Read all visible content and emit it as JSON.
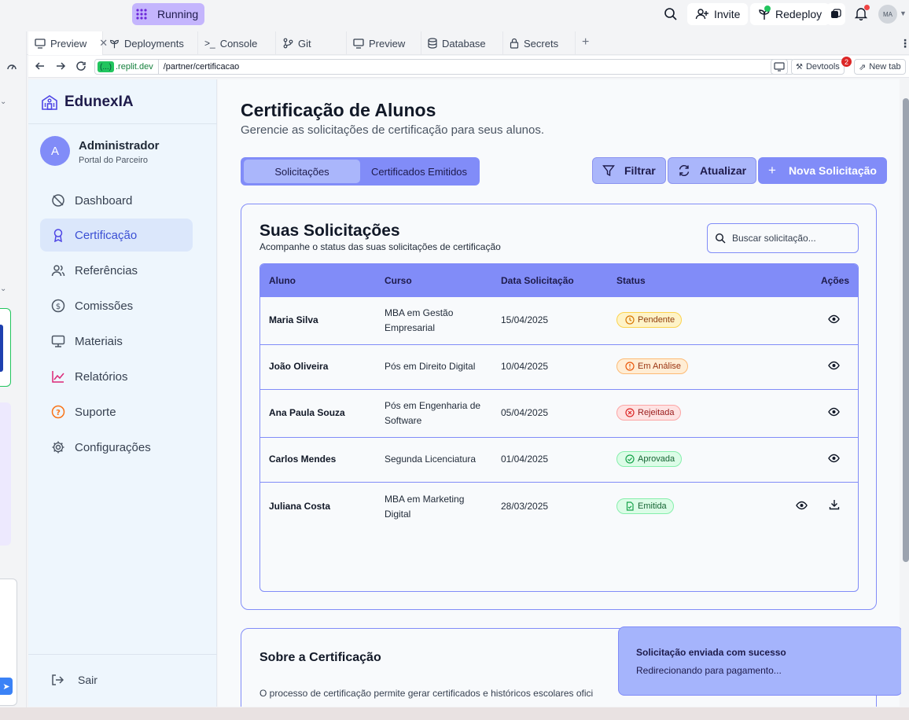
{
  "topbar": {
    "run_status": "Running",
    "invite_label": "Invite",
    "redeploy_label": "Redeploy",
    "avatar_initials": "MA"
  },
  "tabs": [
    {
      "label": "Preview",
      "icon": "monitor-icon",
      "active": true
    },
    {
      "label": "Deployments",
      "icon": "deploy-icon"
    },
    {
      "label": "Console",
      "icon": "terminal-icon"
    },
    {
      "label": "Git",
      "icon": "git-icon"
    },
    {
      "label": "Preview",
      "icon": "monitor-icon"
    },
    {
      "label": "Database",
      "icon": "database-icon"
    },
    {
      "label": "Secrets",
      "icon": "lock-icon"
    }
  ],
  "urlbar": {
    "chip": "(...)",
    "domain": ".replit.dev",
    "path": "/partner/certificacao",
    "devtools_label": "Devtools",
    "devtools_badge": "2",
    "newtab_label": "New tab"
  },
  "sidebar": {
    "brand": "EdunexIA",
    "user_initial": "A",
    "user_name": "Administrador",
    "user_role": "Portal do Parceiro",
    "items": [
      {
        "label": "Dashboard",
        "icon": "dashboard-icon"
      },
      {
        "label": "Certificação",
        "icon": "award-icon",
        "active": true
      },
      {
        "label": "Referências",
        "icon": "users-icon"
      },
      {
        "label": "Comissões",
        "icon": "dollar-icon"
      },
      {
        "label": "Materiais",
        "icon": "monitor-icon"
      },
      {
        "label": "Relatórios",
        "icon": "chart-line-icon"
      },
      {
        "label": "Suporte",
        "icon": "help-icon"
      },
      {
        "label": "Configurações",
        "icon": "gear-icon"
      }
    ],
    "logout_label": "Sair"
  },
  "main": {
    "title": "Certificação de Alunos",
    "subtitle": "Gerencie as solicitações de certificação para seus alunos.",
    "segment": {
      "tab1": "Solicitações",
      "tab2": "Certificados Emitidos"
    },
    "buttons": {
      "filter": "Filtrar",
      "refresh": "Atualizar",
      "new": "Nova Solicitação"
    },
    "requests": {
      "title": "Suas Solicitações",
      "subtitle": "Acompanhe o status das suas solicitações de certificação",
      "search_placeholder": "Buscar solicitação...",
      "columns": [
        "Aluno",
        "Curso",
        "Data Solicitação",
        "Status",
        "Ações"
      ],
      "rows": [
        {
          "student": "Maria Silva",
          "course_line1": "MBA em Gestão",
          "course_line2": "Empresarial",
          "date": "15/04/2025",
          "status": "Pendente",
          "status_color": "#fef3c7"
        },
        {
          "student": "João Oliveira",
          "course_line1": "Pós em Direito Digital",
          "course_line2": "",
          "date": "10/04/2025",
          "status": "Em Análise",
          "status_color": "#ffedd5"
        },
        {
          "student": "Ana Paula Souza",
          "course_line1": "Pós em Engenharia de",
          "course_line2": "Software",
          "date": "05/04/2025",
          "status": "Rejeitada",
          "status_color": "#fee2e2"
        },
        {
          "student": "Carlos Mendes",
          "course_line1": "Segunda Licenciatura",
          "course_line2": "",
          "date": "01/04/2025",
          "status": "Aprovada",
          "status_color": "#dcfce7"
        },
        {
          "student": "Juliana Costa",
          "course_line1": "MBA em Marketing",
          "course_line2": "Digital",
          "date": "28/03/2025",
          "status": "Emitida",
          "status_color": "#dcfce7"
        }
      ]
    },
    "about": {
      "title": "Sobre a Certificação",
      "text": "O processo de certificação permite gerar certificados e históricos escolares ofici"
    }
  },
  "toast": {
    "title": "Solicitação enviada com sucesso",
    "description": "Redirecionando para pagamento..."
  },
  "colors": {
    "accent": "#818cf8",
    "accent_light": "#aab6fb",
    "sidebar_bg": "#eef6fd"
  }
}
